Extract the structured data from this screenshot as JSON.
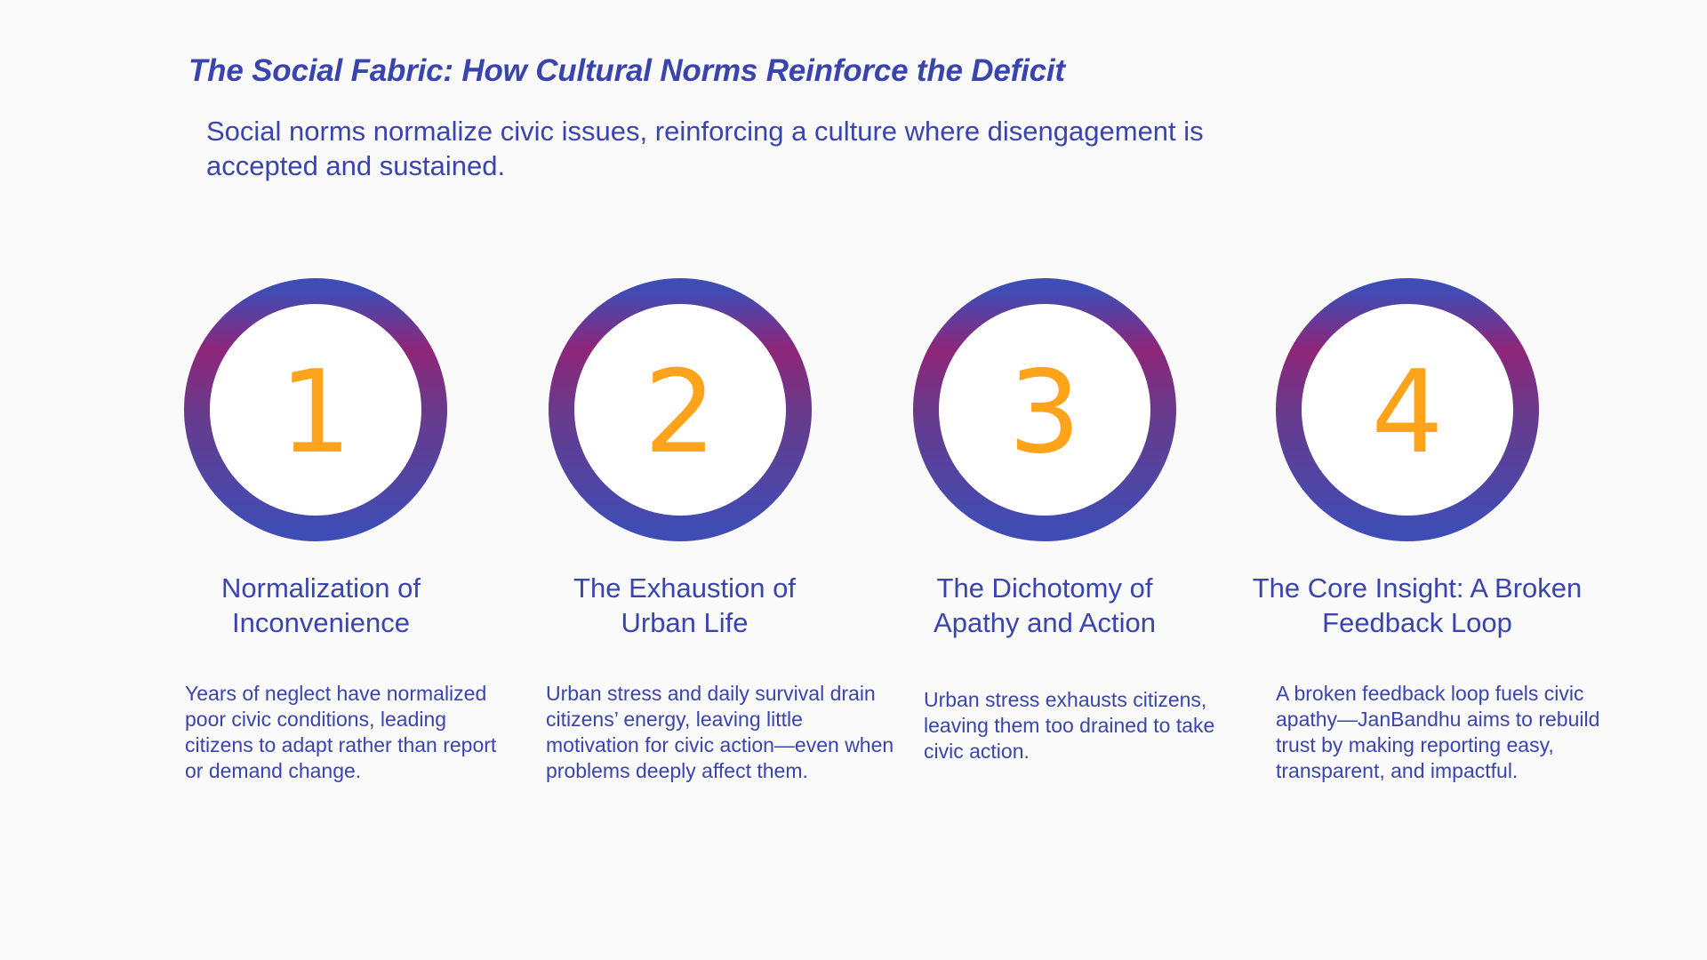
{
  "slide": {
    "title": "The Social Fabric: How Cultural Norms Reinforce the Deficit",
    "subtitle": "Social norms normalize civic issues, reinforcing a culture where disengagement is accepted and sustained."
  },
  "colors": {
    "accent_text": "#3a44ad",
    "number": "#ffa31a",
    "ring_gradient": [
      "#3f4cb4",
      "#8e2679",
      "#6a3a8a",
      "#3f4cb4"
    ],
    "background": "#fafafa"
  },
  "steps": [
    {
      "number": "1",
      "heading": "Normalization of Inconvenience",
      "body": "Years of neglect have normalized poor civic conditions, leading citizens to adapt rather than report or demand change."
    },
    {
      "number": "2",
      "heading": "The Exhaustion of Urban Life",
      "body": "Urban stress and daily survival drain citizens’ energy, leaving little motivation for civic action—even when problems deeply affect them."
    },
    {
      "number": "3",
      "heading": "The Dichotomy of Apathy and Action",
      "body": "Urban stress exhausts citizens, leaving them too drained to take civic action."
    },
    {
      "number": "4",
      "heading": "The Core Insight: A Broken Feedback Loop",
      "body": "A broken feedback loop fuels civic apathy—JanBandhu aims to rebuild trust by making reporting easy, transparent, and impactful."
    }
  ]
}
